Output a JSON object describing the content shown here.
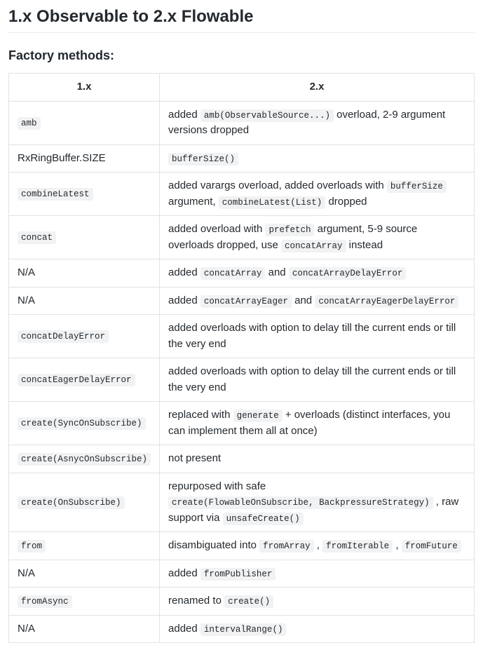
{
  "heading": "1.x Observable to 2.x Flowable",
  "subheading": "Factory methods:",
  "columns": {
    "c1": "1.x",
    "c2": "2.x"
  },
  "rows": [
    {
      "c1": [
        {
          "code": "amb"
        }
      ],
      "c2": [
        {
          "text": "added "
        },
        {
          "code": "amb(ObservableSource...)"
        },
        {
          "text": " overload, 2-9 argument versions dropped"
        }
      ]
    },
    {
      "c1": [
        {
          "text": "RxRingBuffer.SIZE"
        }
      ],
      "c2": [
        {
          "code": "bufferSize()"
        }
      ]
    },
    {
      "c1": [
        {
          "code": "combineLatest"
        }
      ],
      "c2": [
        {
          "text": "added varargs overload, added overloads with "
        },
        {
          "code": "bufferSize"
        },
        {
          "text": " argument, "
        },
        {
          "code": "combineLatest(List)"
        },
        {
          "text": " dropped"
        }
      ]
    },
    {
      "c1": [
        {
          "code": "concat"
        }
      ],
      "c2": [
        {
          "text": "added overload with "
        },
        {
          "code": "prefetch"
        },
        {
          "text": " argument, 5-9 source overloads dropped, use "
        },
        {
          "code": "concatArray"
        },
        {
          "text": " instead"
        }
      ]
    },
    {
      "c1": [
        {
          "text": "N/A"
        }
      ],
      "c2": [
        {
          "text": "added "
        },
        {
          "code": "concatArray"
        },
        {
          "text": " and "
        },
        {
          "code": "concatArrayDelayError"
        }
      ]
    },
    {
      "c1": [
        {
          "text": "N/A"
        }
      ],
      "c2": [
        {
          "text": "added "
        },
        {
          "code": "concatArrayEager"
        },
        {
          "text": " and "
        },
        {
          "code": "concatArrayEagerDelayError"
        }
      ]
    },
    {
      "c1": [
        {
          "code": "concatDelayError"
        }
      ],
      "c2": [
        {
          "text": "added overloads with option to delay till the current ends or till the very end"
        }
      ]
    },
    {
      "c1": [
        {
          "code": "concatEagerDelayError"
        }
      ],
      "c2": [
        {
          "text": "added overloads with option to delay till the current ends or till the very end"
        }
      ]
    },
    {
      "c1": [
        {
          "code": "create(SyncOnSubscribe)"
        }
      ],
      "c2": [
        {
          "text": "replaced with "
        },
        {
          "code": "generate"
        },
        {
          "text": " + overloads (distinct interfaces, you can implement them all at once)"
        }
      ]
    },
    {
      "c1": [
        {
          "code": "create(AsnycOnSubscribe)"
        }
      ],
      "c2": [
        {
          "text": "not present"
        }
      ]
    },
    {
      "c1": [
        {
          "code": "create(OnSubscribe)"
        }
      ],
      "c2": [
        {
          "text": "repurposed with safe "
        },
        {
          "code": "create(FlowableOnSubscribe, BackpressureStrategy)"
        },
        {
          "text": " , raw support via "
        },
        {
          "code": "unsafeCreate()"
        }
      ]
    },
    {
      "c1": [
        {
          "code": "from"
        }
      ],
      "c2": [
        {
          "text": "disambiguated into "
        },
        {
          "code": "fromArray"
        },
        {
          "text": " , "
        },
        {
          "code": "fromIterable"
        },
        {
          "text": " , "
        },
        {
          "code": "fromFuture"
        }
      ]
    },
    {
      "c1": [
        {
          "text": "N/A"
        }
      ],
      "c2": [
        {
          "text": "added "
        },
        {
          "code": "fromPublisher"
        }
      ]
    },
    {
      "c1": [
        {
          "code": "fromAsync"
        }
      ],
      "c2": [
        {
          "text": "renamed to "
        },
        {
          "code": "create()"
        }
      ]
    },
    {
      "c1": [
        {
          "text": "N/A"
        }
      ],
      "c2": [
        {
          "text": "added "
        },
        {
          "code": "intervalRange()"
        }
      ]
    }
  ]
}
